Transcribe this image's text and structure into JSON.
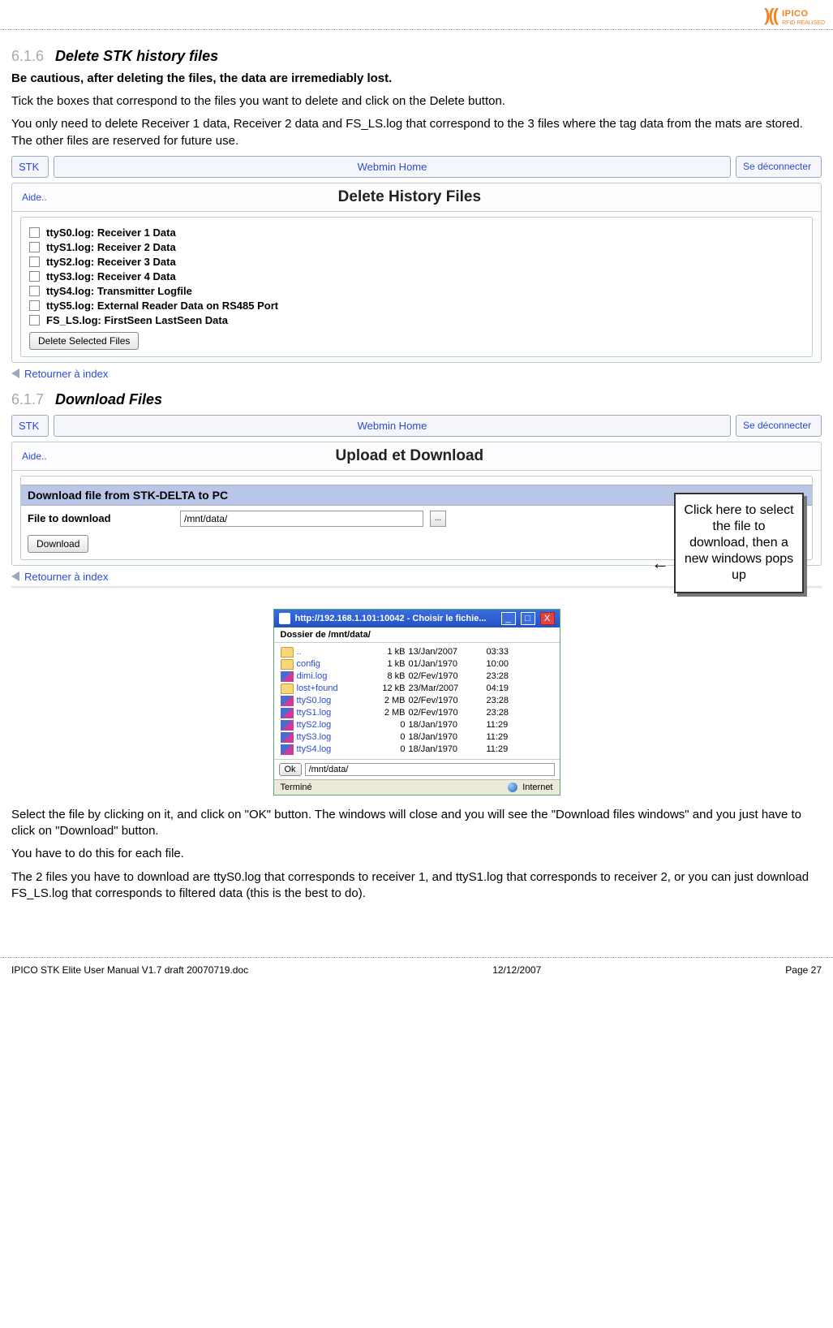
{
  "logo": {
    "brand": "IPICO",
    "tag": "RFID REALISED"
  },
  "s616": {
    "num": "6.1.6",
    "title": "Delete STK history files",
    "warn": "Be cautious, after deleting the files, the data are irremediably lost.",
    "p1": "Tick the boxes that correspond to the files you want to delete and click on the Delete button.",
    "p2": "You only need to delete Receiver 1 data, Receiver 2 data and FS_LS.log that correspond to the 3 files where the tag data from the mats are stored. The other files are reserved for future use."
  },
  "wm": {
    "stk": "STK",
    "home": "Webmin Home",
    "logout": "Se déconnecter",
    "aide": "Aide..",
    "del_title": "Delete History Files",
    "upload_title": "Upload et Download",
    "return": "Retourner à index",
    "del_btn": "Delete Selected Files",
    "files": [
      "ttyS0.log: Receiver 1 Data",
      "ttyS1.log: Receiver 2 Data",
      "ttyS2.log: Receiver 3 Data",
      "ttyS3.log: Receiver 4 Data",
      "ttyS4.log: Transmitter Logfile",
      "ttyS5.log: External Reader Data on RS485 Port",
      "FS_LS.log: FirstSeen LastSeen Data"
    ]
  },
  "s617": {
    "num": "6.1.7",
    "title": "Download Files",
    "dl_section": "Download file from STK-DELTA to PC",
    "dl_label": "File to download",
    "dl_path": "/mnt/data/",
    "dl_btn": "Download",
    "annotation": "Click here to select the file to download, then a new windows pops up",
    "p1": "Select the file by clicking on it, and click on \"OK\" button. The windows will close and you will see the \"Download files windows\" and you just have to click on \"Download\" button.",
    "p2": "You have to do this for each file.",
    "p3": "The 2 files you have to download are ttyS0.log that corresponds to receiver 1, and ttyS1.log that corresponds to receiver 2, or you can just download FS_LS.log that corresponds to filtered data (this is the best to do)."
  },
  "popup": {
    "title": "http://192.168.1.101:10042 - Choisir le fichie...",
    "header": "Dossier de /mnt/data/",
    "path": "/mnt/data/",
    "ok": "Ok",
    "done": "Terminé",
    "zone": "Internet",
    "rows": [
      {
        "icon": "folder",
        "name": "..",
        "size": "1 kB",
        "date": "13/Jan/2007",
        "time": "03:33"
      },
      {
        "icon": "folder",
        "name": "config",
        "size": "1 kB",
        "date": "01/Jan/1970",
        "time": "10:00"
      },
      {
        "icon": "unk",
        "name": "dimi.log",
        "size": "8 kB",
        "date": "02/Fev/1970",
        "time": "23:28"
      },
      {
        "icon": "folder",
        "name": "lost+found",
        "size": "12 kB",
        "date": "23/Mar/2007",
        "time": "04:19"
      },
      {
        "icon": "unk",
        "name": "ttyS0.log",
        "size": "2 MB",
        "date": "02/Fev/1970",
        "time": "23:28"
      },
      {
        "icon": "unk",
        "name": "ttyS1.log",
        "size": "2 MB",
        "date": "02/Fev/1970",
        "time": "23:28"
      },
      {
        "icon": "unk",
        "name": "ttyS2.log",
        "size": "0",
        "date": "18/Jan/1970",
        "time": "11:29"
      },
      {
        "icon": "unk",
        "name": "ttyS3.log",
        "size": "0",
        "date": "18/Jan/1970",
        "time": "11:29"
      },
      {
        "icon": "unk",
        "name": "ttyS4.log",
        "size": "0",
        "date": "18/Jan/1970",
        "time": "11:29"
      }
    ]
  },
  "footer": {
    "left": "IPICO STK Elite User Manual V1.7 draft 20070719.doc",
    "mid": "12/12/2007",
    "right": "Page 27"
  }
}
